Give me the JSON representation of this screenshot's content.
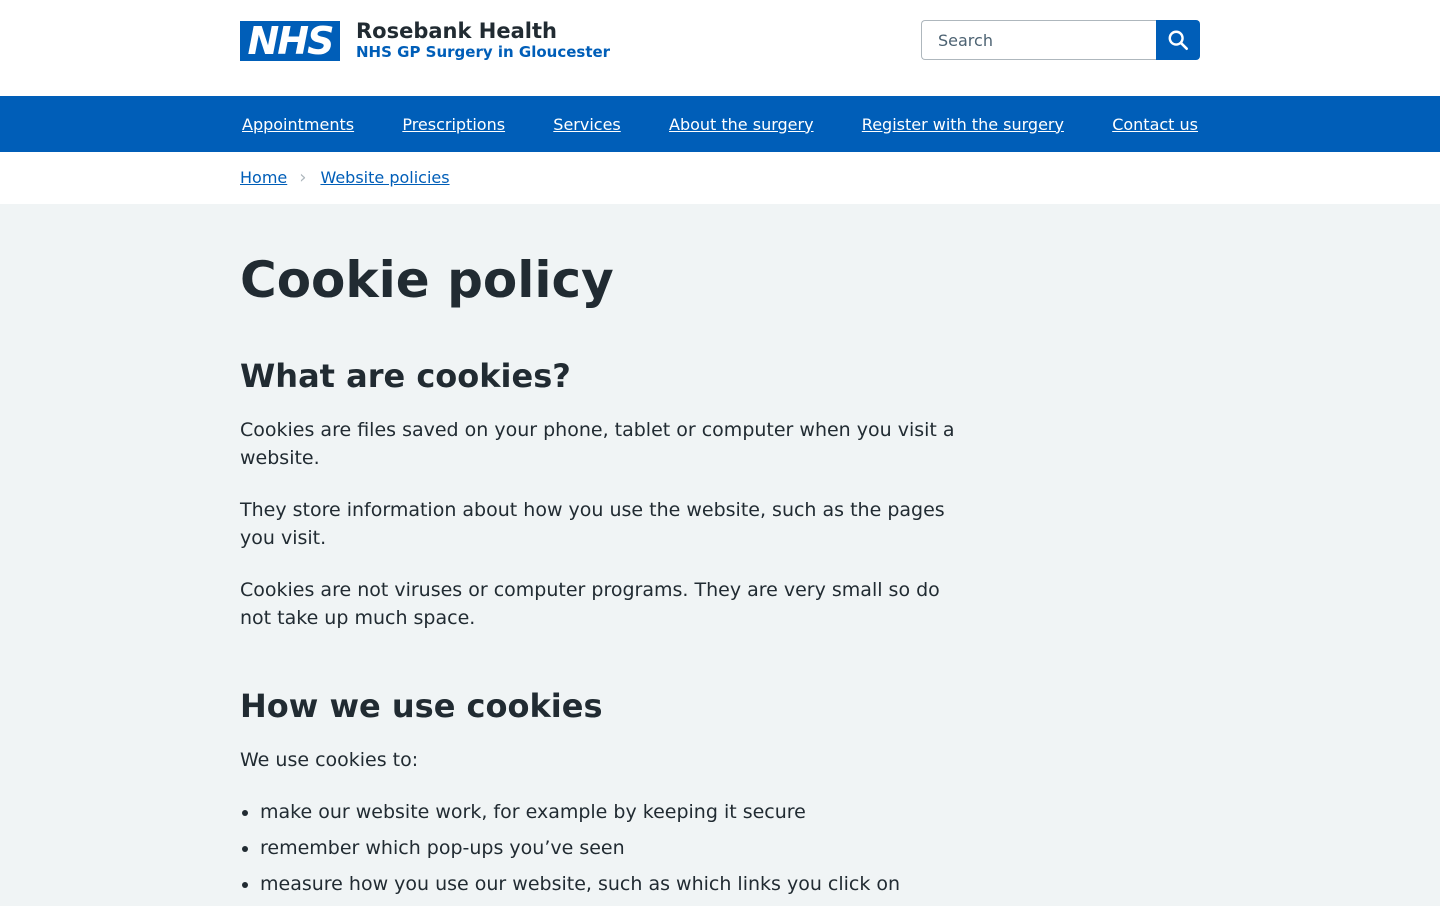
{
  "header": {
    "logo_text": "NHS",
    "org_title": "Rosebank Health",
    "org_subtitle": "NHS GP Surgery in Gloucester",
    "search": {
      "placeholder": "Search",
      "button_icon": "search-icon"
    }
  },
  "nav": {
    "items": [
      {
        "label": "Appointments"
      },
      {
        "label": "Prescriptions"
      },
      {
        "label": "Services"
      },
      {
        "label": "About the surgery"
      },
      {
        "label": "Register with the surgery"
      },
      {
        "label": "Contact us"
      }
    ]
  },
  "breadcrumb": {
    "items": [
      {
        "label": "Home"
      },
      {
        "label": "Website policies"
      }
    ],
    "separator_icon": "chevron-right-icon"
  },
  "content": {
    "title": "Cookie policy",
    "section1": {
      "heading": "What are cookies?",
      "paragraphs": [
        "Cookies are files saved on your phone, tablet or computer when you visit a website.",
        "They store information about how you use the website, such as the pages you visit.",
        "Cookies are not viruses or computer programs. They are very small so do not take up much space."
      ]
    },
    "section2": {
      "heading": "How we use cookies",
      "intro": "We use cookies to:",
      "bullets": [
        "make our website work, for example by keeping it secure",
        "remember which pop-ups you’ve seen",
        "measure how you use our website, such as which links you click on"
      ]
    }
  },
  "colors": {
    "nhs_blue": "#005eb8",
    "text": "#212b32",
    "page_background": "#f0f4f5",
    "white": "#ffffff"
  }
}
